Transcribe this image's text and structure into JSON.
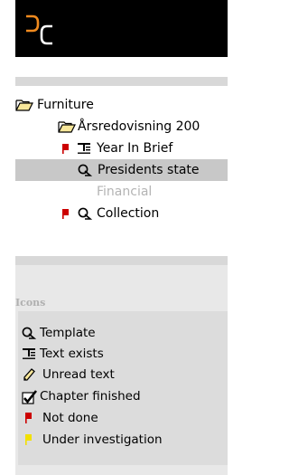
{
  "tree": {
    "items": [
      {
        "label": "Furniture",
        "icon": "open-folder-icon",
        "state": "normal"
      },
      {
        "label": "Årsredovisning 200",
        "icon": "open-folder-icon",
        "state": "normal"
      },
      {
        "label": "Year In Brief",
        "icon": "text-exists-icon",
        "flag": "not-done-flag-icon",
        "state": "normal"
      },
      {
        "label": "Presidents state",
        "icon": "template-icon",
        "state": "selected"
      },
      {
        "label": "Financial",
        "state": "disabled"
      },
      {
        "label": "Collection",
        "icon": "template-icon",
        "flag": "not-done-flag-icon",
        "state": "normal"
      }
    ]
  },
  "icons_panel": {
    "title": "Icons",
    "legend": [
      {
        "label": "Template",
        "icon": "template-icon"
      },
      {
        "label": "Text exists",
        "icon": "text-exists-icon"
      },
      {
        "label": "Unread text",
        "icon": "pencil-icon"
      },
      {
        "label": "Chapter finished",
        "icon": "checkmark-icon"
      },
      {
        "label": "Not done",
        "icon": "red-flag-icon"
      },
      {
        "label": "Under investigation",
        "icon": "yellow-flag-icon"
      }
    ]
  },
  "colors": {
    "header_bg": "#000000",
    "logo_accent": "#f08a1e",
    "selected_row": "#c8c8c8",
    "not_done_flag": "#cc0000",
    "investigation_flag": "#f2e000",
    "icons_panel_bg": "#e8e8e8"
  }
}
